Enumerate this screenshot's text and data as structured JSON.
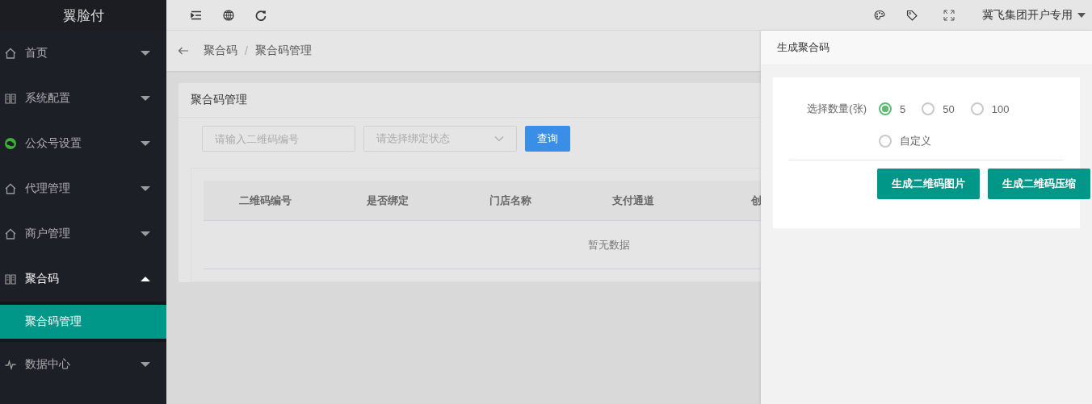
{
  "app_title": "翼脸付",
  "user_menu": {
    "label": "冀飞集团开户专用"
  },
  "sidebar": {
    "items": [
      {
        "label": "首页",
        "expanded": false
      },
      {
        "label": "系统配置",
        "expanded": false
      },
      {
        "label": "公众号设置",
        "expanded": false
      },
      {
        "label": "代理管理",
        "expanded": false
      },
      {
        "label": "商户管理",
        "expanded": false
      },
      {
        "label": "聚合码",
        "expanded": true,
        "children": [
          {
            "label": "聚合码管理",
            "selected": true
          }
        ]
      },
      {
        "label": "数据中心",
        "expanded": false
      }
    ]
  },
  "breadcrumb": [
    "聚合码",
    "聚合码管理"
  ],
  "breadcrumb_separator": "/",
  "card": {
    "title": "聚合码管理",
    "filters": {
      "code_placeholder": "请输入二维码编号",
      "status_placeholder": "请选择绑定状态",
      "search_button": "查询"
    },
    "table": {
      "columns": [
        "二维码编号",
        "是否绑定",
        "门店名称",
        "支付通道",
        "创"
      ],
      "empty_text": "暂无数据"
    }
  },
  "drawer": {
    "title": "生成聚合码",
    "quantity_label": "选择数量(张)",
    "options": [
      {
        "label": "5",
        "selected": true
      },
      {
        "label": "50",
        "selected": false
      },
      {
        "label": "100",
        "selected": false
      },
      {
        "label": "自定义",
        "selected": false
      }
    ],
    "buttons": [
      "生成二维码图片",
      "生成二维码压缩"
    ]
  }
}
